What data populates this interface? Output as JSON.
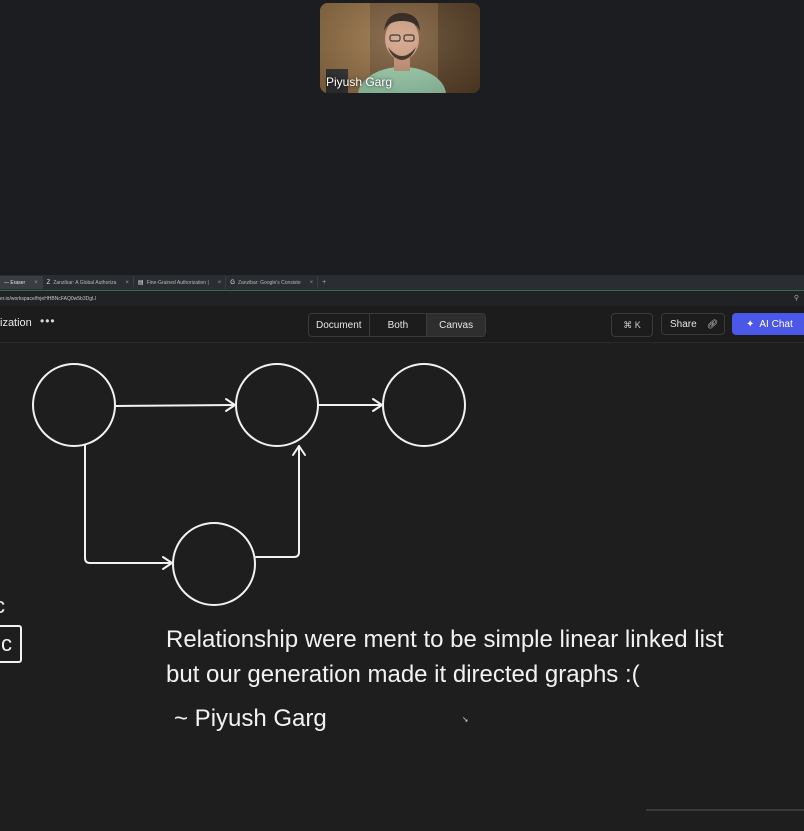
{
  "video": {
    "participant_name": "Piyush Garg"
  },
  "browser": {
    "tabs": [
      {
        "label": "— Eraser",
        "favicon": "",
        "active": true
      },
      {
        "label": "Zanzibar: A Global Authoriza",
        "favicon": "Z",
        "active": false
      },
      {
        "label": "Fine-Grained Authorization |",
        "favicon": "doc-icon",
        "active": false
      },
      {
        "label": "Zanzibar: Google's Consiste",
        "favicon": "G",
        "active": false
      }
    ],
    "url": "er.io/workspace/fnjeHHBNcFAQ0w5b3DgLl"
  },
  "toolbar": {
    "file_title": "ization",
    "more_label": "•••",
    "views": [
      "Document",
      "Both",
      "Canvas"
    ],
    "active_view": "Canvas",
    "shortcut": "⌘ K",
    "share_label": "Share",
    "ai_chat_label": "AI Chat"
  },
  "canvas": {
    "text_line1": "Relationship were ment to be simple linear linked list",
    "text_line2": "but our generation made it directed graphs :(",
    "signature": "~ Piyush Garg",
    "partial_left": "c",
    "partial_left_top": "c"
  }
}
